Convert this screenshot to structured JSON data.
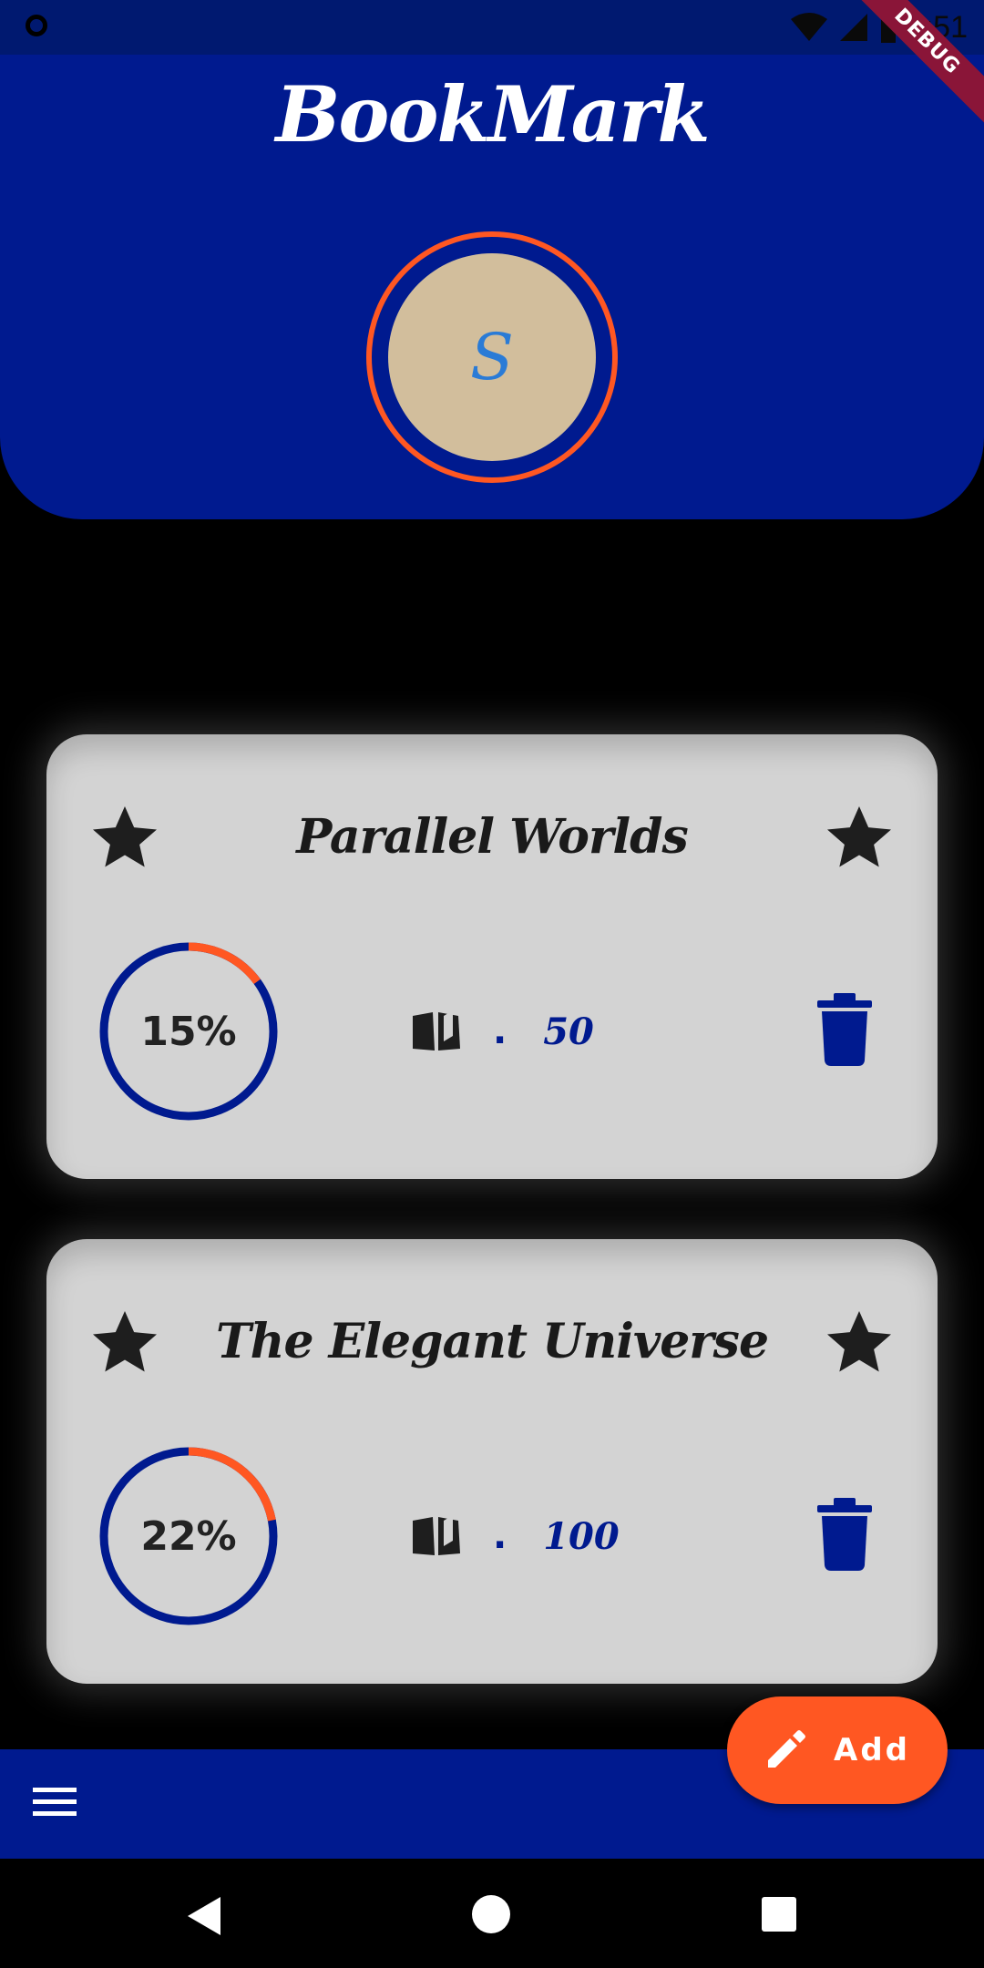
{
  "status_bar": {
    "time": "8:51",
    "debug_label": "DEBUG"
  },
  "app": {
    "title": "BookMark"
  },
  "profile": {
    "initial": "S"
  },
  "books": [
    {
      "title": "Parallel Worlds",
      "progress_label": "15%",
      "progress": 0.15,
      "pages": "50"
    },
    {
      "title": "The Elegant Universe",
      "progress_label": "22%",
      "progress": 0.22,
      "pages": "100"
    }
  ],
  "pages_separator": ".",
  "fab": {
    "label": "Add"
  },
  "icons": {
    "menu": "menu-icon",
    "star": "star-icon",
    "book": "book-open-icon",
    "delete": "trash-icon",
    "edit": "pencil-icon",
    "nav_back": "back-triangle-icon",
    "nav_home": "home-circle-icon",
    "nav_recent": "recents-square-icon"
  },
  "colors": {
    "primary": "#001a8f",
    "accent": "#ff5722",
    "avatar_bg": "#d2be9c",
    "avatar_text": "#2a7bd6",
    "card_bg": "#d3d3d3",
    "background": "#000000"
  }
}
